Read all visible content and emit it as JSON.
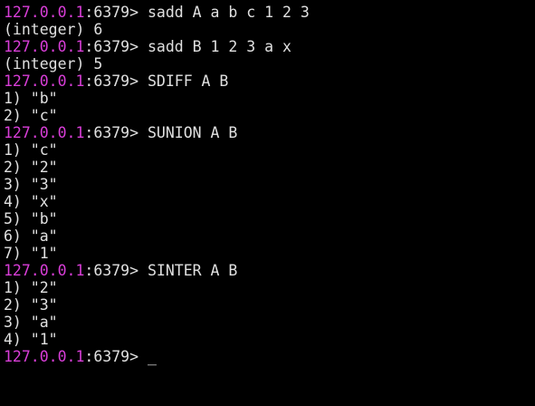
{
  "prompt": {
    "host": "127.0.0.1",
    "port_suffix": ":6379> "
  },
  "colors": {
    "background": "#000000",
    "text": "#e0e0e0",
    "prompt_host": "#d93ed8"
  },
  "lines": [
    {
      "type": "cmd",
      "text": "sadd A a b c 1 2 3"
    },
    {
      "type": "out",
      "text": "(integer) 6"
    },
    {
      "type": "cmd",
      "text": "sadd B 1 2 3 a x"
    },
    {
      "type": "out",
      "text": "(integer) 5"
    },
    {
      "type": "cmd",
      "text": "SDIFF A B"
    },
    {
      "type": "out",
      "text": "1) \"b\""
    },
    {
      "type": "out",
      "text": "2) \"c\""
    },
    {
      "type": "cmd",
      "text": "SUNION A B"
    },
    {
      "type": "out",
      "text": "1) \"c\""
    },
    {
      "type": "out",
      "text": "2) \"2\""
    },
    {
      "type": "out",
      "text": "3) \"3\""
    },
    {
      "type": "out",
      "text": "4) \"x\""
    },
    {
      "type": "out",
      "text": "5) \"b\""
    },
    {
      "type": "out",
      "text": "6) \"a\""
    },
    {
      "type": "out",
      "text": "7) \"1\""
    },
    {
      "type": "cmd",
      "text": "SINTER A B"
    },
    {
      "type": "out",
      "text": "1) \"2\""
    },
    {
      "type": "out",
      "text": "2) \"3\""
    },
    {
      "type": "out",
      "text": "3) \"a\""
    },
    {
      "type": "out",
      "text": "4) \"1\""
    },
    {
      "type": "cmd",
      "text": "_"
    }
  ]
}
